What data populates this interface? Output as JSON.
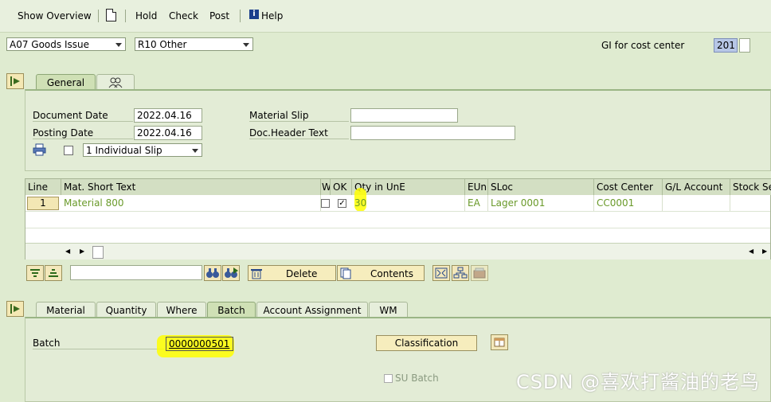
{
  "toolbar": {
    "show_overview": "Show Overview",
    "hold": "Hold",
    "check": "Check",
    "post": "Post",
    "help": "Help"
  },
  "header": {
    "transaction": "A07 Goods Issue",
    "reference": "R10 Other",
    "movement_label": "GI for cost center",
    "movement_type": "201"
  },
  "header_tabs": [
    "General"
  ],
  "general": {
    "document_date_label": "Document Date",
    "document_date": "2022.04.16",
    "posting_date_label": "Posting Date",
    "posting_date": "2022.04.16",
    "material_slip_label": "Material Slip",
    "material_slip": "",
    "doc_header_label": "Doc.Header Text",
    "doc_header": "",
    "print_option": "1 Individual Slip"
  },
  "grid": {
    "columns": [
      "Line",
      "Mat. Short Text",
      "W",
      "OK",
      "Qty in UnE",
      "EUn",
      "SLoc",
      "Cost Center",
      "G/L Account",
      "Stock Se"
    ],
    "rows": [
      {
        "line": "1",
        "text": "Material 800",
        "w": "",
        "ok": "✓",
        "qty": "30",
        "eun": "EA",
        "sloc": "Lager 0001",
        "cost_center": "CC0001",
        "gl": "",
        "stock": ""
      }
    ]
  },
  "actions": {
    "delete": "Delete",
    "contents": "Contents"
  },
  "item_tabs": [
    "Material",
    "Quantity",
    "Where",
    "Batch",
    "Account Assignment",
    "WM"
  ],
  "batch": {
    "label": "Batch",
    "value": "0000000501",
    "classification": "Classification",
    "su_batch": "SU Batch"
  },
  "watermark": "CSDN @喜欢打酱油的老鸟",
  "colors": {
    "background": "#dfebd0",
    "highlight": "#ffff00",
    "grid_text": "#6a9a2a"
  }
}
